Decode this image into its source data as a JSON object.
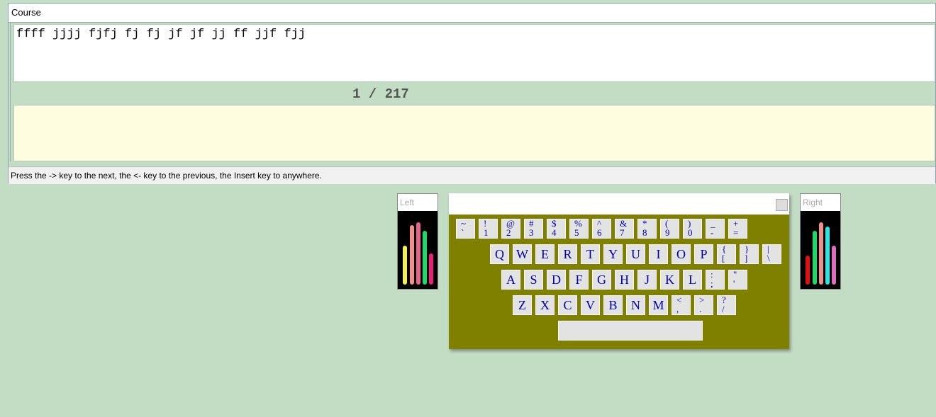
{
  "course_window": {
    "title": "Course",
    "lesson_text": "ffff jjjj fjfj fj fj jf jf jj ff jjf fjj",
    "page_counter": "1 / 217",
    "typed_text": "",
    "status_text": "Press the -> key to the next, the <- key to the previous, the Insert key to anywhere."
  },
  "left_hand": {
    "title": "Left",
    "fingers": [
      {
        "color": "#f5f05a",
        "level": 0.62
      },
      {
        "color": "#f08d8d",
        "level": 0.96
      },
      {
        "color": "#e8648a",
        "level": 1.0
      },
      {
        "color": "#22d66a",
        "level": 0.86
      },
      {
        "color": "#ea1f77",
        "level": 0.5
      }
    ]
  },
  "right_hand": {
    "title": "Right",
    "fingers": [
      {
        "color": "#e01010",
        "level": 0.47
      },
      {
        "color": "#22d66a",
        "level": 0.86
      },
      {
        "color": "#f08d8d",
        "level": 1.0
      },
      {
        "color": "#2de2e0",
        "level": 0.93
      },
      {
        "color": "#e06ec0",
        "level": 0.62
      }
    ]
  },
  "keyboard": {
    "rows": [
      [
        [
          "~",
          "`"
        ],
        [
          "!",
          "1"
        ],
        [
          "@",
          "2"
        ],
        [
          "#",
          "3"
        ],
        [
          "$",
          "4"
        ],
        [
          "%",
          "5"
        ],
        [
          "^",
          "6"
        ],
        [
          "&",
          "7"
        ],
        [
          "*",
          "8"
        ],
        [
          "(",
          "9"
        ],
        [
          ")",
          "0"
        ],
        [
          "_",
          "-"
        ],
        [
          "+",
          "="
        ]
      ],
      [
        [
          "Q"
        ],
        [
          "W"
        ],
        [
          "E"
        ],
        [
          "R"
        ],
        [
          "T"
        ],
        [
          "Y"
        ],
        [
          "U"
        ],
        [
          "I"
        ],
        [
          "O"
        ],
        [
          "P"
        ],
        [
          "{",
          "["
        ],
        [
          "}",
          "]"
        ],
        [
          "|",
          "\\"
        ]
      ],
      [
        [
          "A"
        ],
        [
          "S"
        ],
        [
          "D"
        ],
        [
          "F"
        ],
        [
          "G"
        ],
        [
          "H"
        ],
        [
          "J"
        ],
        [
          "K"
        ],
        [
          "L"
        ],
        [
          ":",
          ";"
        ],
        [
          "\"",
          "'"
        ]
      ],
      [
        [
          "Z"
        ],
        [
          "X"
        ],
        [
          "C"
        ],
        [
          "V"
        ],
        [
          "B"
        ],
        [
          "N"
        ],
        [
          "M"
        ],
        [
          "<",
          ","
        ],
        [
          ">",
          "."
        ],
        [
          "?",
          "/"
        ]
      ]
    ]
  }
}
